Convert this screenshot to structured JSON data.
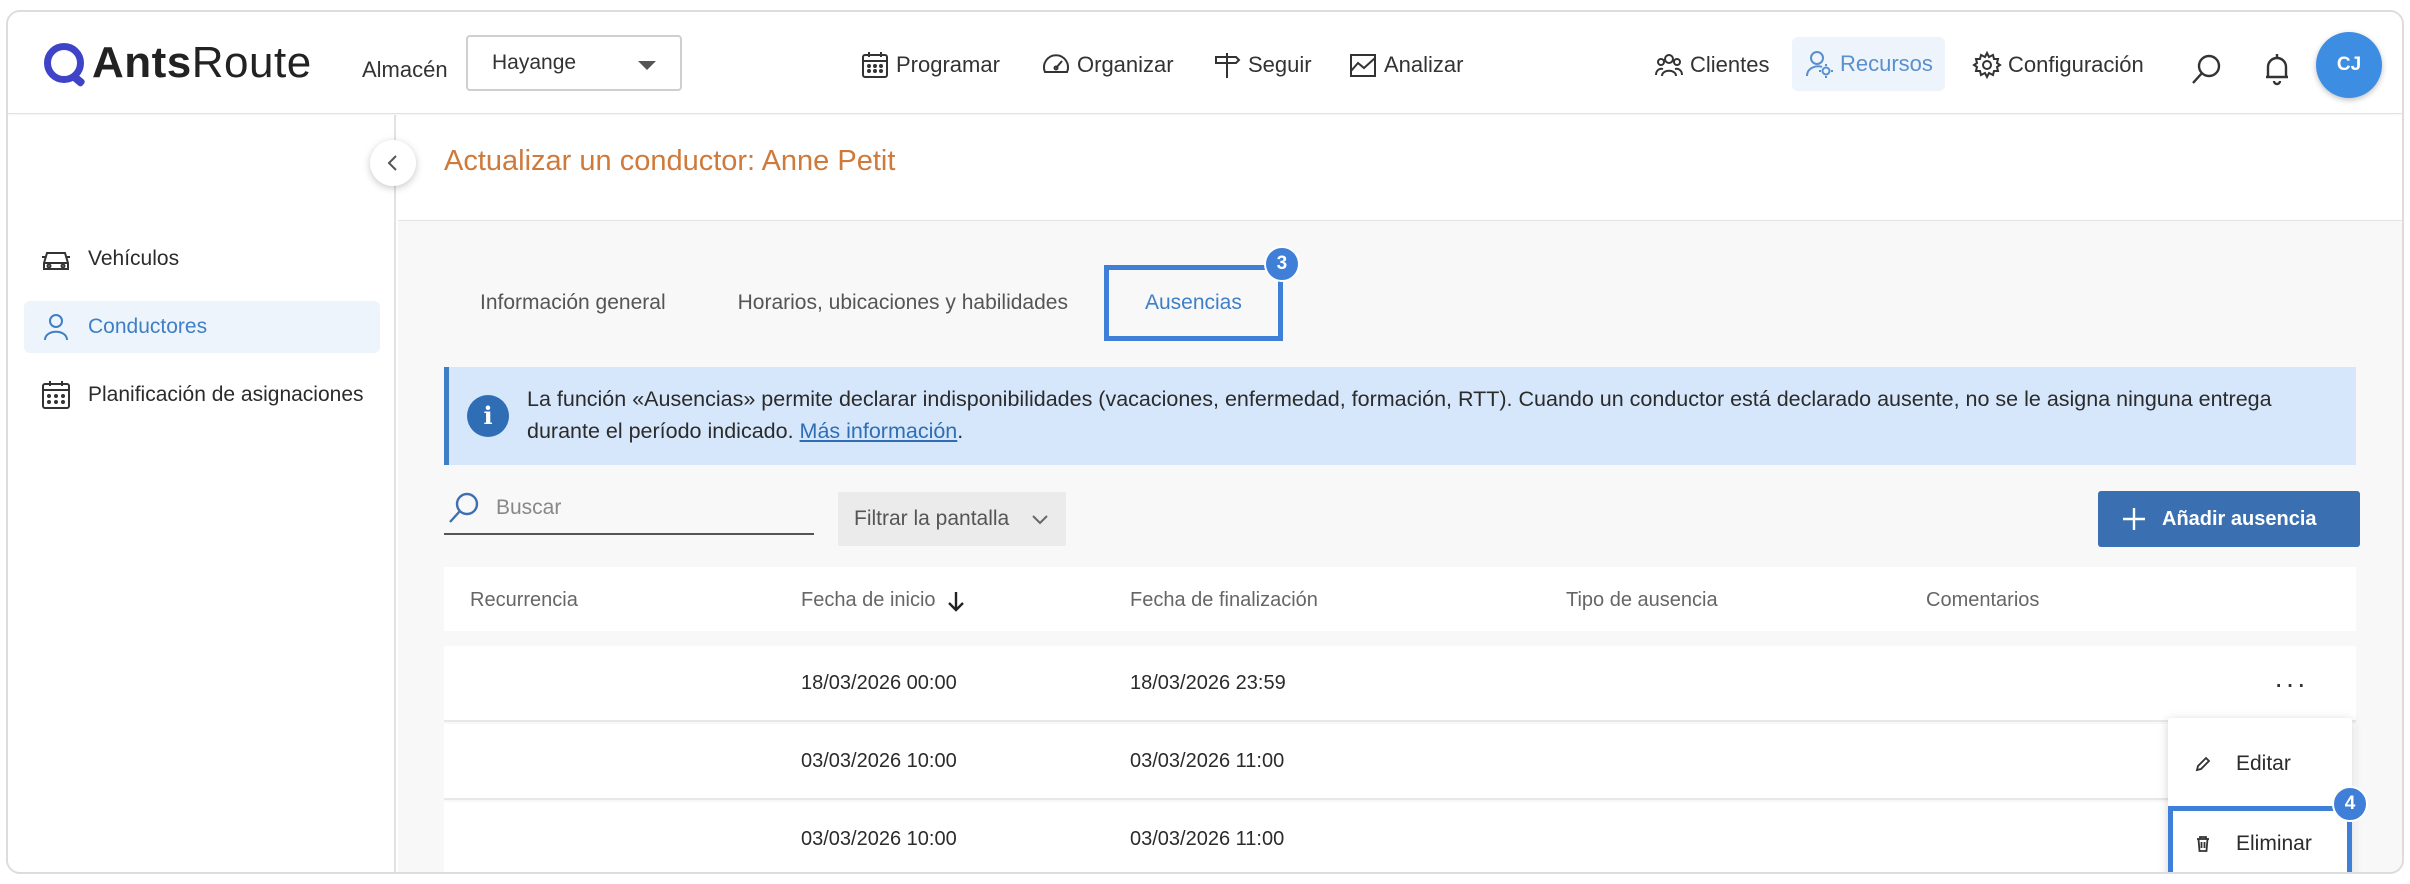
{
  "app": {
    "brand_bold": "Ants",
    "brand_light": "Route"
  },
  "header": {
    "warehouse_label": "Almacén",
    "warehouse_value": "Hayange",
    "nav": {
      "schedule": "Programar",
      "organize": "Organizar",
      "track": "Seguir",
      "analyze": "Analizar",
      "clients": "Clientes",
      "resources": "Recursos",
      "settings": "Configuración"
    },
    "avatar_initials": "CJ"
  },
  "sidebar": {
    "items": [
      {
        "label": "Vehículos",
        "icon": "car-icon"
      },
      {
        "label": "Conductores",
        "icon": "user-icon",
        "active": true
      },
      {
        "label": "Planificación de asignaciones",
        "icon": "calendar-icon"
      }
    ]
  },
  "page": {
    "title": "Actualizar un conductor: Anne Petit",
    "tabs": [
      {
        "label": "Información general"
      },
      {
        "label": "Horarios, ubicaciones y habilidades"
      },
      {
        "label": "Ausencias",
        "active": true
      }
    ],
    "tab_step_badge": "3",
    "info": {
      "text": "La función «Ausencias» permite declarar indisponibilidades (vacaciones, enfermedad, formación, RTT). Cuando un conductor está declarado ausente, no se le asigna ninguna entrega durante el período indicado.",
      "link": "Más información",
      "end": "."
    },
    "search_placeholder": "Buscar",
    "filter_label": "Filtrar la pantalla",
    "add_button": "Añadir ausencia",
    "table": {
      "columns": [
        "Recurrencia",
        "Fecha de inicio",
        "Fecha de finalización",
        "Tipo de ausencia",
        "Comentarios"
      ],
      "rows": [
        {
          "recurrence": "",
          "start": "18/03/2026 00:00",
          "end": "18/03/2026 23:59",
          "type": "",
          "comments": ""
        },
        {
          "recurrence": "",
          "start": "03/03/2026 10:00",
          "end": "03/03/2026 11:00",
          "type": "",
          "comments": ""
        },
        {
          "recurrence": "",
          "start": "03/03/2026 10:00",
          "end": "03/03/2026 11:00",
          "type": "",
          "comments": ""
        }
      ]
    },
    "row_menu": {
      "edit": "Editar",
      "delete": "Eliminar",
      "step_badge": "4"
    }
  },
  "colors": {
    "accent": "#3f7fd8",
    "title": "#cf7a3b",
    "primary_button": "#3a6fb1",
    "info_bg": "#d6e7fb"
  }
}
